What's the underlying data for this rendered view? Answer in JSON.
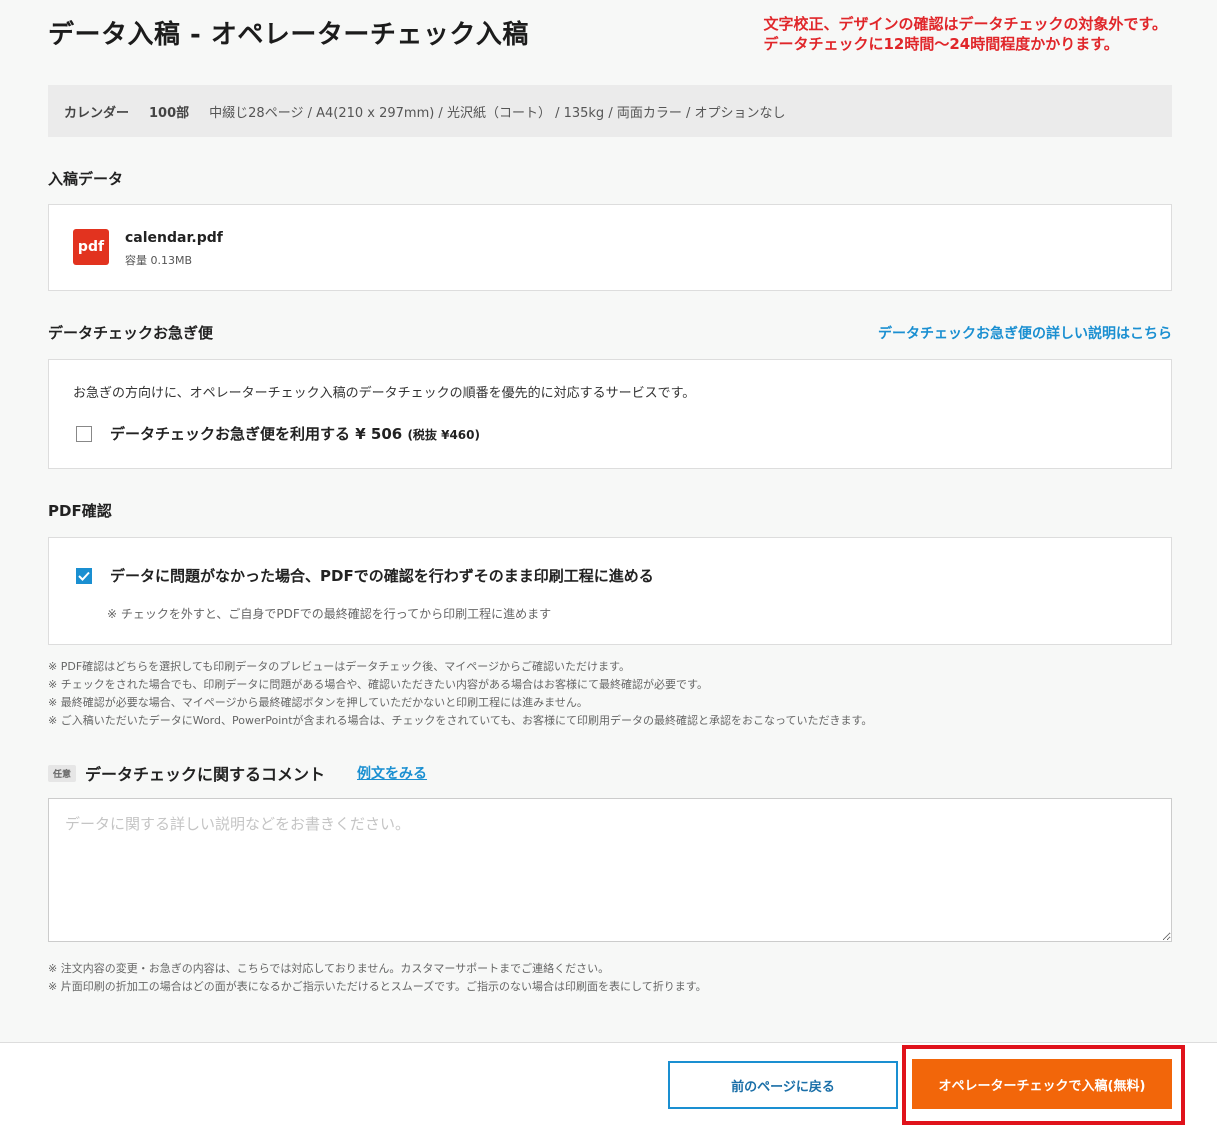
{
  "page": {
    "title": "データ入稿 - オペレーターチェック入稿",
    "notice_line1": "文字校正、デザインの確認はデータチェックの対象外です。",
    "notice_line2": "データチェックに12時間〜24時間程度かかります。"
  },
  "spec": {
    "product": "カレンダー",
    "quantity": "100部",
    "details": "中綴じ28ページ / A4(210 x 297mm) / 光沢紙（コート） / 135kg / 両面カラー / オプションなし"
  },
  "upload": {
    "section_title": "入稿データ",
    "file_icon_label": "pdf",
    "file_name": "calendar.pdf",
    "file_size": "容量 0.13MB"
  },
  "express": {
    "section_title": "データチェックお急ぎ便",
    "detail_link": "データチェックお急ぎ便の詳しい説明はこちら",
    "description": "お急ぎの方向けに、オペレーターチェック入稿のデータチェックの順番を優先的に対応するサービスです。",
    "option_label": "データチェックお急ぎ便を利用する ¥ 506",
    "option_tax": "(税抜 ¥460)",
    "checked": false
  },
  "pdf_confirm": {
    "section_title": "PDF確認",
    "option_label": "データに問題がなかった場合、PDFでの確認を行わずそのまま印刷工程に進める",
    "sub_note": "※ チェックを外すと、ご自身でPDFでの最終確認を行ってから印刷工程に進めます",
    "checked": true
  },
  "notes": [
    "※ PDF確認はどちらを選択しても印刷データのプレビューはデータチェック後、マイページからご確認いただけます。",
    "※ チェックをされた場合でも、印刷データに問題がある場合や、確認いただきたい内容がある場合はお客様にて最終確認が必要です。",
    "※ 最終確認が必要な場合、マイページから最終確認ボタンを押していただかないと印刷工程には進みません。",
    "※ ご入稿いただいたデータにWord、PowerPointが含まれる場合は、チェックをされていても、お客様にて印刷用データの最終確認と承認をおこなっていただきます。"
  ],
  "comment": {
    "tag": "任意",
    "title": "データチェックに関するコメント",
    "example_link": "例文をみる",
    "placeholder": "データに関する詳しい説明などをお書きください。",
    "value": ""
  },
  "footer_notes": [
    "※ 注文内容の変更・お急ぎの内容は、こちらでは対応しておりません。カスタマーサポートまでご連絡ください。",
    "※ 片面印刷の折加工の場合はどの面が表になるかご指示いただけるとスムーズです。ご指示のない場合は印刷面を表にして折ります。"
  ],
  "actions": {
    "back_label": "前のページに戻る",
    "submit_label": "オペレーターチェックで入稿(無料)"
  },
  "colors": {
    "accent_blue": "#1a8fd1",
    "notice_red": "#e0262a",
    "submit_orange": "#f2660a",
    "pdf_red": "#e2331f",
    "highlight_red": "#e0121b"
  }
}
